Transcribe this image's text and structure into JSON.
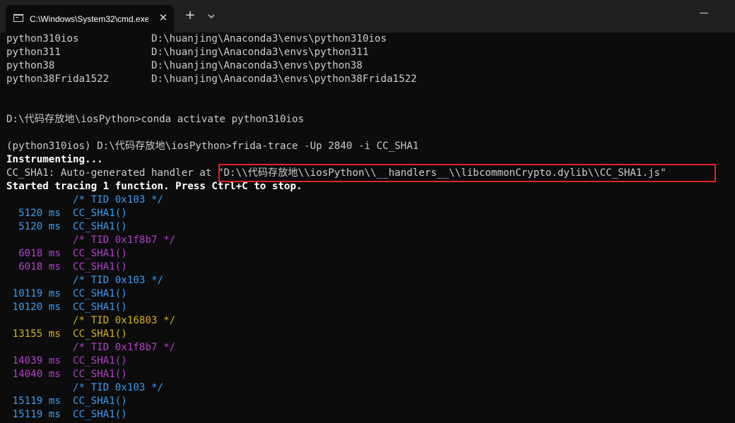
{
  "window": {
    "tab_title": "C:\\Windows\\System32\\cmd.exe",
    "close_glyph": "✕",
    "new_tab_glyph": "+"
  },
  "terminal": {
    "env_lines": [
      "python310ios            D:\\huanjing\\Anaconda3\\envs\\python310ios",
      "python311               D:\\huanjing\\Anaconda3\\envs\\python311",
      "python38                D:\\huanjing\\Anaconda3\\envs\\python38",
      "python38Frida1522       D:\\huanjing\\Anaconda3\\envs\\python38Frida1522"
    ],
    "activate_command": "D:\\代码存放地\\iosPython>conda activate python310ios",
    "trace_command": "(python310ios) D:\\代码存放地\\iosPython>frida-trace -Up 2840 -i CC_SHA1",
    "instrumenting": "Instrumenting...",
    "handler_line": "CC_SHA1: Auto-generated handler at \"D:\\\\代码存放地\\\\iosPython\\\\__handlers__\\\\libcommonCrypto.dylib\\\\CC_SHA1.js\"",
    "started_line": "Started tracing 1 function. Press Ctrl+C to stop.",
    "trace": [
      {
        "text": "           /* TID 0x103 */",
        "color": "blue"
      },
      {
        "text": "  5120 ms  CC_SHA1()",
        "color": "blue"
      },
      {
        "text": "  5120 ms  CC_SHA1()",
        "color": "blue"
      },
      {
        "text": "           /* TID 0x1f8b7 */",
        "color": "purple"
      },
      {
        "text": "  6018 ms  CC_SHA1()",
        "color": "purple"
      },
      {
        "text": "  6018 ms  CC_SHA1()",
        "color": "purple"
      },
      {
        "text": "           /* TID 0x103 */",
        "color": "blue"
      },
      {
        "text": " 10119 ms  CC_SHA1()",
        "color": "blue"
      },
      {
        "text": " 10120 ms  CC_SHA1()",
        "color": "blue"
      },
      {
        "text": "           /* TID 0x16803 */",
        "color": "yellow"
      },
      {
        "text": " 13155 ms  CC_SHA1()",
        "color": "yellow"
      },
      {
        "text": "           /* TID 0x1f8b7 */",
        "color": "purple"
      },
      {
        "text": " 14039 ms  CC_SHA1()",
        "color": "purple"
      },
      {
        "text": " 14040 ms  CC_SHA1()",
        "color": "purple"
      },
      {
        "text": "           /* TID 0x103 */",
        "color": "blue"
      },
      {
        "text": " 15119 ms  CC_SHA1()",
        "color": "blue"
      },
      {
        "text": " 15119 ms  CC_SHA1()",
        "color": "blue"
      }
    ]
  },
  "colors": {
    "background": "#0c0c0c",
    "titlebar": "#202020",
    "text": "#cccccc",
    "tid_blue": "#3b9bf0",
    "tid_purple": "#b040c8",
    "tid_yellow": "#d4b020",
    "highlight": "#e0242a"
  }
}
